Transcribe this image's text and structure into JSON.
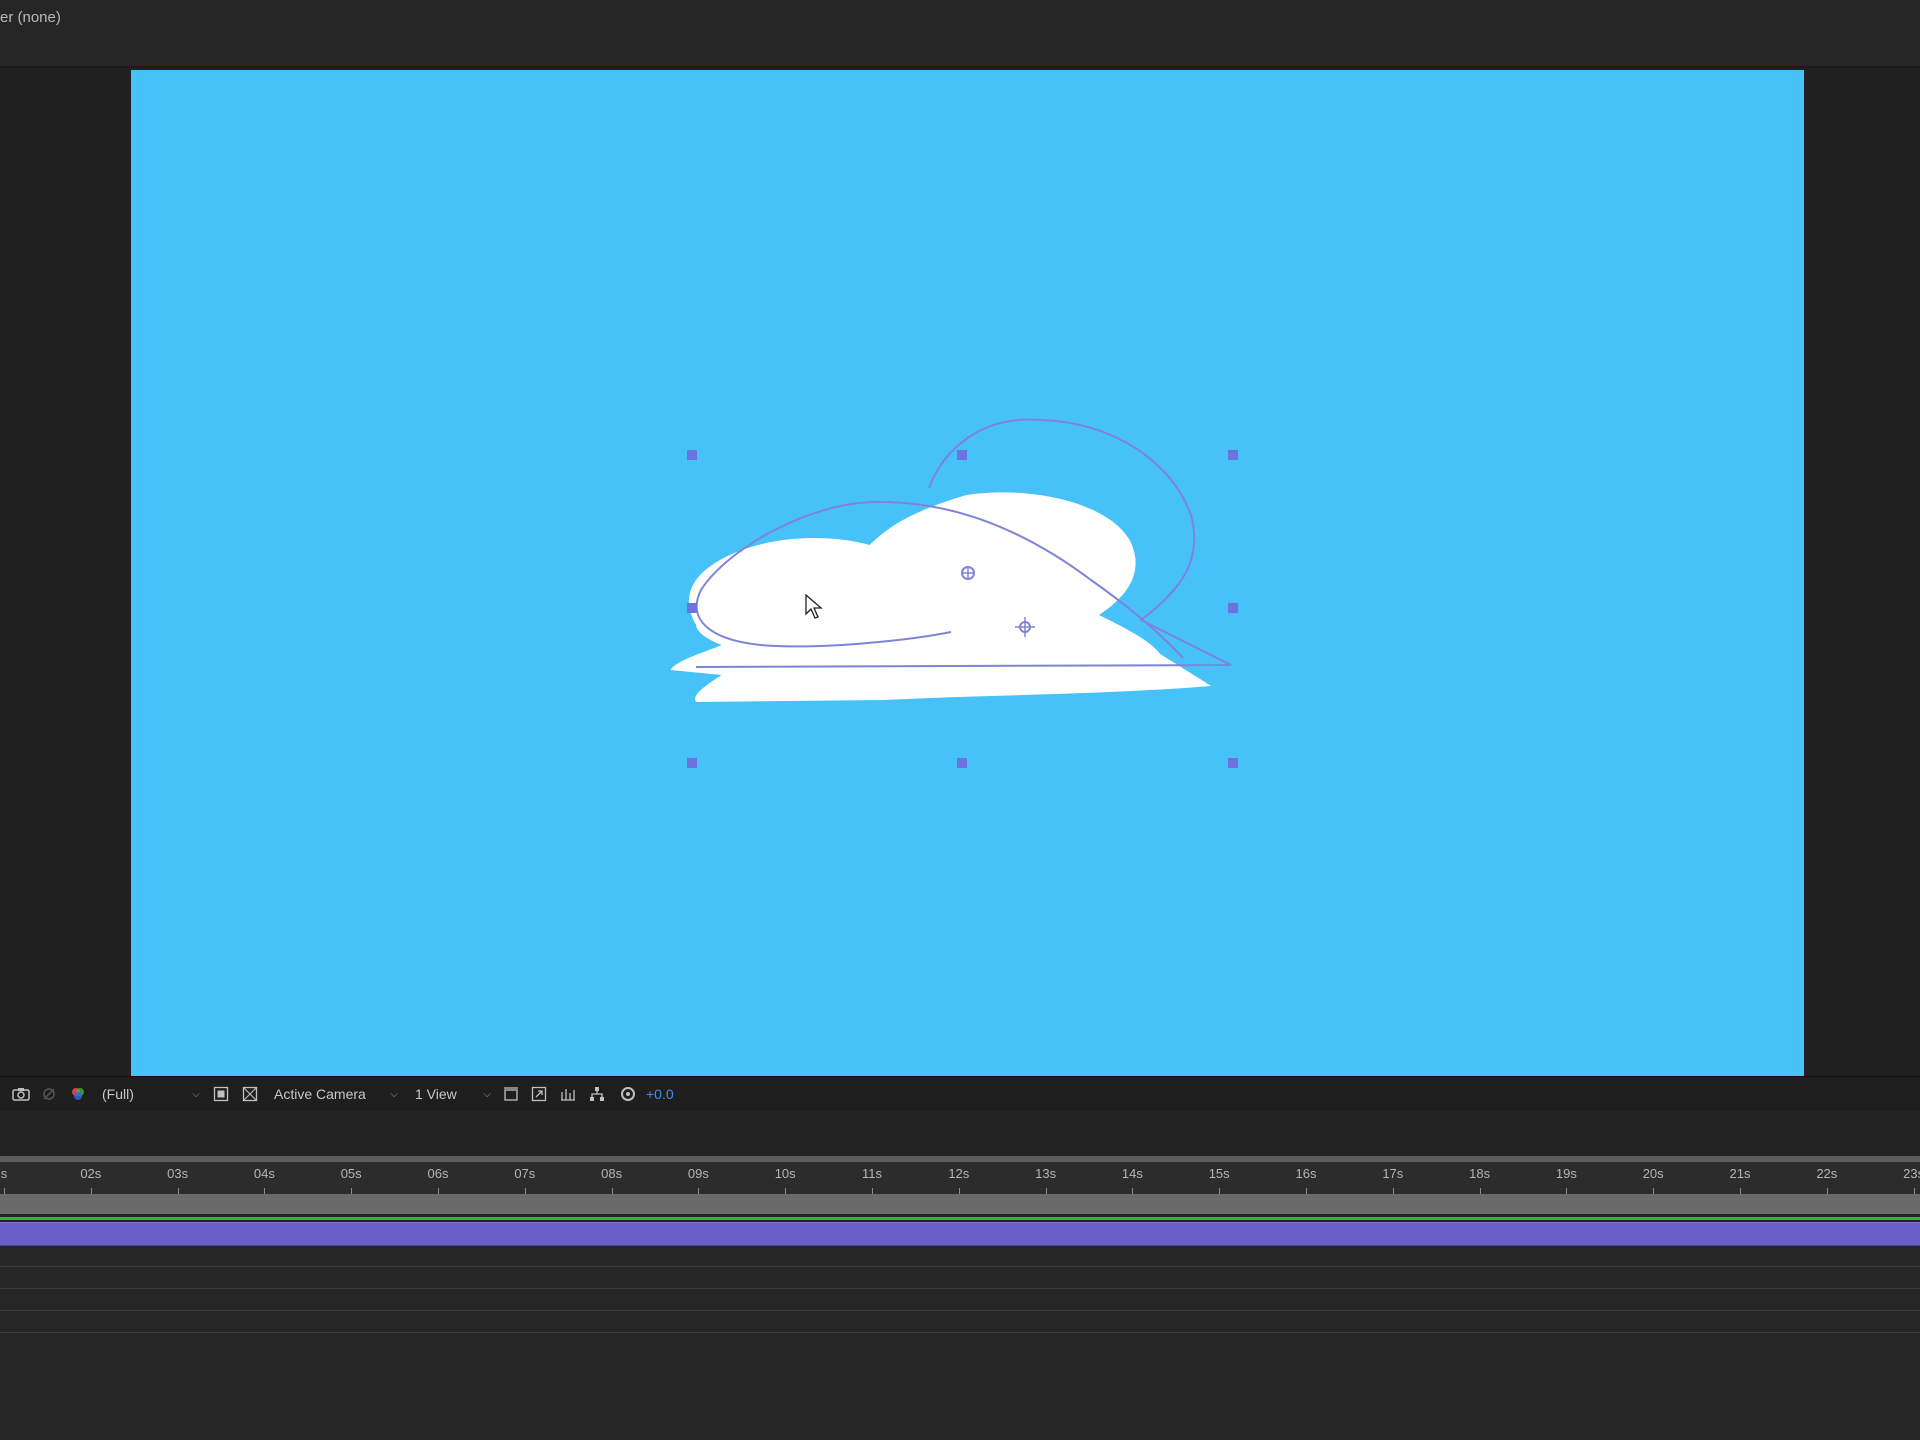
{
  "top_bar": {
    "layer_label": "er (none)"
  },
  "viewer": {
    "background_color": "#47c2f9",
    "shape_color": "#ffffff",
    "path_color": "#7f84d8",
    "handle_color": "#6c72e0"
  },
  "viewer_toolbar": {
    "snapshot_icon": "camera-icon",
    "show_snapshot_icon": "show-snapshot-icon",
    "channel_icon": "color-channels-icon",
    "resolution": "(Full)",
    "region_icon": "region-of-interest-icon",
    "transparency_icon": "transparency-grid-icon",
    "camera": "Active Camera",
    "views": "1 View",
    "exposure": "+0.0"
  },
  "timeline": {
    "ticks": [
      "s",
      "02s",
      "03s",
      "04s",
      "05s",
      "06s",
      "07s",
      "08s",
      "09s",
      "10s",
      "11s",
      "12s",
      "13s",
      "14s",
      "15s",
      "16s",
      "17s",
      "18s",
      "19s",
      "20s",
      "21s",
      "22s",
      "23s"
    ],
    "layer_bar_color": "#6a5fc8",
    "work_area_color": "#2eb82e"
  }
}
